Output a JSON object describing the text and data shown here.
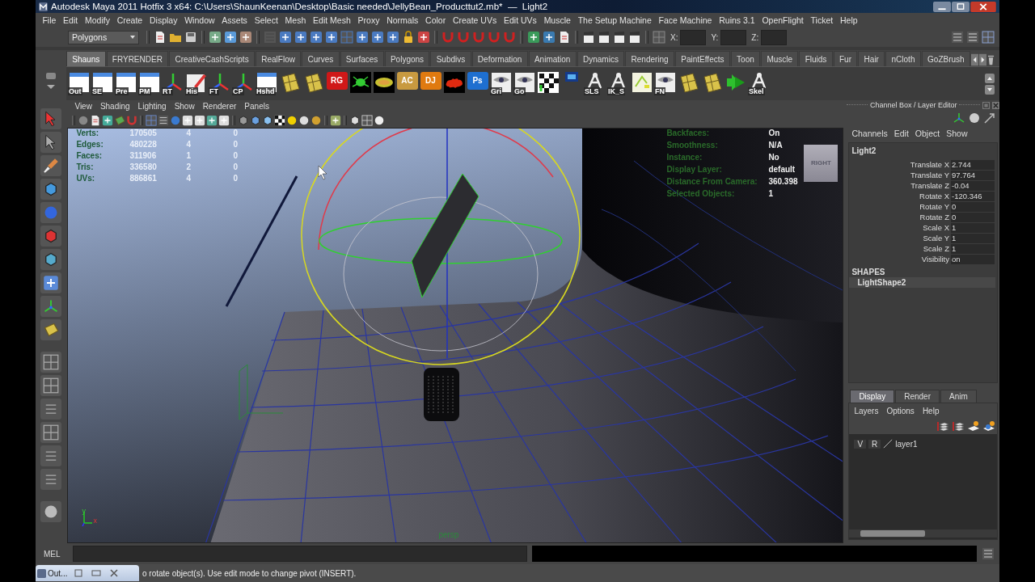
{
  "window": {
    "title": "Autodesk Maya 2011 Hotfix 3 x64: C:\\Users\\ShaunKeenan\\Desktop\\Basic needed\\JellyBean_Producttut2.mb*  —  Light2"
  },
  "menu": [
    "File",
    "Edit",
    "Modify",
    "Create",
    "Display",
    "Window",
    "Assets",
    "Select",
    "Mesh",
    "Edit Mesh",
    "Proxy",
    "Normals",
    "Color",
    "Create UVs",
    "Edit UVs",
    "Muscle",
    "The Setup Machine",
    "Face Machine",
    "Ruins 3.1",
    "OpenFlight",
    "Ticket",
    "Help"
  ],
  "status_line": {
    "mode": "Polygons",
    "coords": [
      "X:",
      "Y:",
      "Z:"
    ]
  },
  "shelf": {
    "tabs": [
      {
        "label": "Shauns",
        "selected": true
      },
      {
        "label": "FRYRENDER",
        "selected": false
      },
      {
        "label": "CreativeCashScripts",
        "selected": false
      },
      {
        "label": "RealFlow",
        "selected": false
      },
      {
        "label": "Curves",
        "selected": false
      },
      {
        "label": "Surfaces",
        "selected": false
      },
      {
        "label": "Polygons",
        "selected": false
      },
      {
        "label": "Subdivs",
        "selected": false
      },
      {
        "label": "Deformation",
        "selected": false
      },
      {
        "label": "Animation",
        "selected": false
      },
      {
        "label": "Dynamics",
        "selected": false
      },
      {
        "label": "Rendering",
        "selected": false
      },
      {
        "label": "PaintEffects",
        "selected": false
      },
      {
        "label": "Toon",
        "selected": false
      },
      {
        "label": "Muscle",
        "selected": false
      },
      {
        "label": "Fluids",
        "selected": false
      },
      {
        "label": "Fur",
        "selected": false
      },
      {
        "label": "Hair",
        "selected": false
      },
      {
        "label": "nCloth",
        "selected": false
      },
      {
        "label": "GoZBrush",
        "selected": false
      }
    ],
    "items": [
      {
        "kind": "window",
        "label": "Out"
      },
      {
        "kind": "window",
        "label": "SE"
      },
      {
        "kind": "window",
        "label": "Pre"
      },
      {
        "kind": "window",
        "label": "PM"
      },
      {
        "kind": "axes",
        "label": "RT"
      },
      {
        "kind": "note",
        "label": "His"
      },
      {
        "kind": "axes",
        "label": "FT"
      },
      {
        "kind": "axes",
        "label": "CP"
      },
      {
        "kind": "window",
        "label": "Hshd"
      },
      {
        "kind": "tile"
      },
      {
        "kind": "tile"
      },
      {
        "kind": "badge",
        "text": "RG",
        "color": "#d01818"
      },
      {
        "kind": "bug"
      },
      {
        "kind": "oval"
      },
      {
        "kind": "badge",
        "text": "AC",
        "color": "#c89a40"
      },
      {
        "kind": "badge",
        "text": "DJ",
        "color": "#e07a10"
      },
      {
        "kind": "blob"
      },
      {
        "kind": "badge",
        "text": "Ps",
        "color": "#1e6fd0"
      },
      {
        "kind": "eye",
        "label": "Gri"
      },
      {
        "kind": "eye",
        "label": "Go"
      },
      {
        "kind": "checker"
      },
      {
        "kind": "chip"
      },
      {
        "kind": "bone",
        "label": "SLS"
      },
      {
        "kind": "bone",
        "label": "IK_S"
      },
      {
        "kind": "sketch"
      },
      {
        "kind": "eye",
        "label": "FN"
      },
      {
        "kind": "tile"
      },
      {
        "kind": "tile"
      },
      {
        "kind": "arrow"
      },
      {
        "kind": "bone",
        "label": "Skel"
      }
    ]
  },
  "viewport": {
    "menu": [
      "View",
      "Shading",
      "Lighting",
      "Show",
      "Renderer",
      "Panels"
    ],
    "hud_stats": [
      {
        "label": "Verts:",
        "values": [
          "170505",
          "4",
          "0"
        ]
      },
      {
        "label": "Edges:",
        "values": [
          "480228",
          "4",
          "0"
        ]
      },
      {
        "label": "Faces:",
        "values": [
          "311906",
          "1",
          "0"
        ]
      },
      {
        "label": "Tris:",
        "values": [
          "336580",
          "2",
          "0"
        ]
      },
      {
        "label": "UVs:",
        "values": [
          "886861",
          "4",
          "0"
        ]
      }
    ],
    "hud_info": [
      {
        "label": "Backfaces:",
        "value": "On"
      },
      {
        "label": "Smoothness:",
        "value": "N/A"
      },
      {
        "label": "Instance:",
        "value": "No"
      },
      {
        "label": "Display Layer:",
        "value": "default"
      },
      {
        "label": "Distance From Camera:",
        "value": "360.398"
      },
      {
        "label": "Selected Objects:",
        "value": "1"
      }
    ],
    "view_cube": "RIGHT",
    "camera": "persp",
    "axis": [
      "y",
      "x"
    ]
  },
  "channel_box": {
    "title": "Channel Box / Layer Editor",
    "menu": [
      "Channels",
      "Edit",
      "Object",
      "Show"
    ],
    "object": "Light2",
    "channels": [
      {
        "name": "Translate X",
        "value": "2.744"
      },
      {
        "name": "Translate Y",
        "value": "97.764"
      },
      {
        "name": "Translate Z",
        "value": "-0.04"
      },
      {
        "name": "Rotate X",
        "value": "-120.346"
      },
      {
        "name": "Rotate Y",
        "value": "0"
      },
      {
        "name": "Rotate Z",
        "value": "0"
      },
      {
        "name": "Scale X",
        "value": "1"
      },
      {
        "name": "Scale Y",
        "value": "1"
      },
      {
        "name": "Scale Z",
        "value": "1"
      },
      {
        "name": "Visibility",
        "value": "on"
      }
    ],
    "shapes_heading": "SHAPES",
    "shapes": [
      "LightShape2"
    ]
  },
  "layer_editor": {
    "tabs": [
      {
        "label": "Display",
        "selected": true
      },
      {
        "label": "Render",
        "selected": false
      },
      {
        "label": "Anim",
        "selected": false
      }
    ],
    "menu": [
      "Layers",
      "Options",
      "Help"
    ],
    "layers": [
      {
        "visible": "V",
        "render": "R",
        "name": "layer1"
      }
    ]
  },
  "command_line": {
    "label": "MEL"
  },
  "minimized_window": {
    "title": "Out..."
  },
  "help_line": "o rotate object(s). Use edit mode to change pivot (INSERT)."
}
